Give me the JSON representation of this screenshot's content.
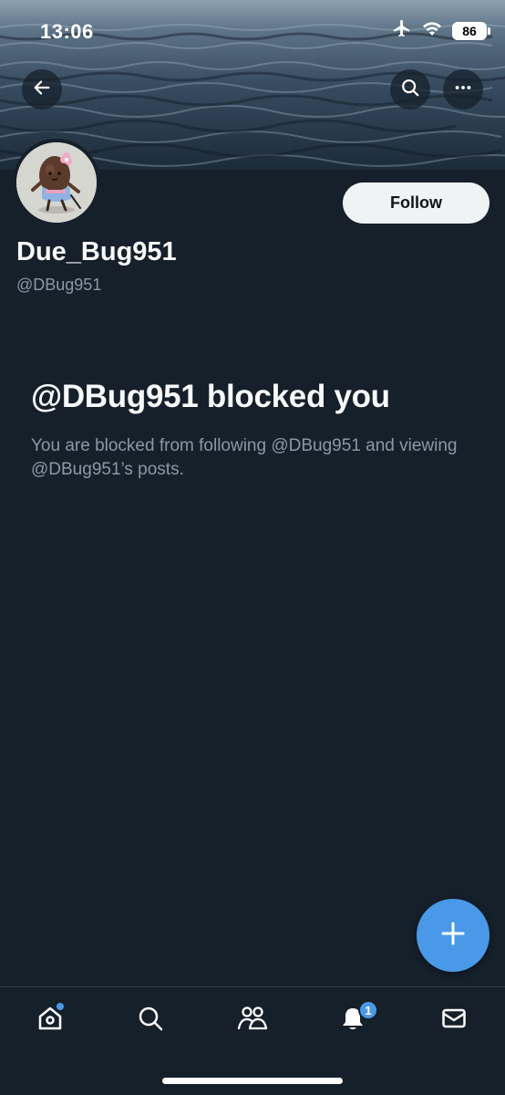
{
  "status_bar": {
    "time": "13:06",
    "battery": "86"
  },
  "header": {
    "back_icon": "arrow-left-icon",
    "search_icon": "search-icon",
    "more_icon": "more-horizontal-icon"
  },
  "profile": {
    "display_name": "Due_Bug951",
    "handle": "@DBug951",
    "follow_label": "Follow"
  },
  "blocked": {
    "title": "@DBug951 blocked you",
    "description": "You are blocked from following @DBug951 and viewing @DBug951’s posts."
  },
  "fab": {
    "icon": "plus-icon"
  },
  "bottom_nav": {
    "items": [
      {
        "name": "home",
        "icon": "home-icon",
        "has_dot": true
      },
      {
        "name": "search",
        "icon": "search-icon"
      },
      {
        "name": "communities",
        "icon": "people-icon"
      },
      {
        "name": "notifications",
        "icon": "bell-icon",
        "badge": "1"
      },
      {
        "name": "messages",
        "icon": "mail-icon"
      }
    ]
  },
  "colors": {
    "background": "#15202b",
    "accent": "#4a99e9",
    "text_primary": "#f7f9f9",
    "text_secondary": "#8b98a5",
    "follow_bg": "#eff3f4"
  }
}
